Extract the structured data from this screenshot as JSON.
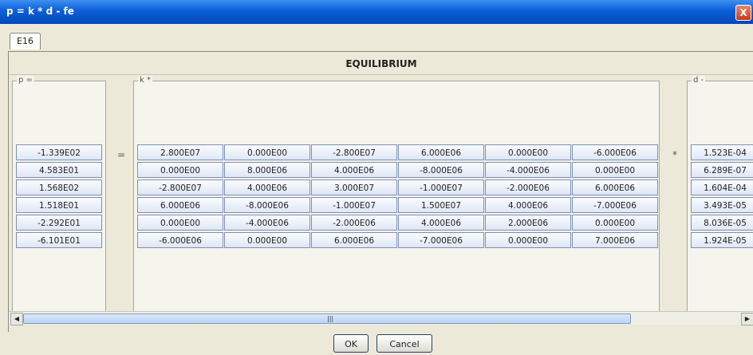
{
  "window": {
    "title": "p = k * d - fe",
    "close_glyph": "X"
  },
  "tabs": [
    {
      "label": "E16"
    }
  ],
  "section_title": "EQUILIBRIUM",
  "panels": {
    "p_label": "p =",
    "k_label": "k *",
    "d_label": "d -"
  },
  "operators": {
    "equals": "=",
    "times": "*"
  },
  "p": [
    "-1.339E02",
    "4.583E01",
    "1.568E02",
    "1.518E01",
    "-2.292E01",
    "-6.101E01"
  ],
  "k": [
    [
      "2.800E07",
      "0.000E00",
      "-2.800E07",
      "6.000E06",
      "0.000E00",
      "-6.000E06"
    ],
    [
      "0.000E00",
      "8.000E06",
      "4.000E06",
      "-8.000E06",
      "-4.000E06",
      "0.000E00"
    ],
    [
      "-2.800E07",
      "4.000E06",
      "3.000E07",
      "-1.000E07",
      "-2.000E06",
      "6.000E06"
    ],
    [
      "6.000E06",
      "-8.000E06",
      "-1.000E07",
      "1.500E07",
      "4.000E06",
      "-7.000E06"
    ],
    [
      "0.000E00",
      "-4.000E06",
      "-2.000E06",
      "4.000E06",
      "2.000E06",
      "0.000E00"
    ],
    [
      "-6.000E06",
      "0.000E00",
      "6.000E06",
      "-7.000E06",
      "0.000E00",
      "7.000E06"
    ]
  ],
  "d": [
    "1.523E-04",
    "6.289E-07",
    "1.604E-04",
    "3.493E-05",
    "8.036E-05",
    "1.924E-05"
  ],
  "buttons": {
    "ok": "OK",
    "cancel": "Cancel"
  },
  "icons": {
    "close": "close-icon",
    "left": "scroll-left-icon",
    "right": "scroll-right-icon"
  }
}
